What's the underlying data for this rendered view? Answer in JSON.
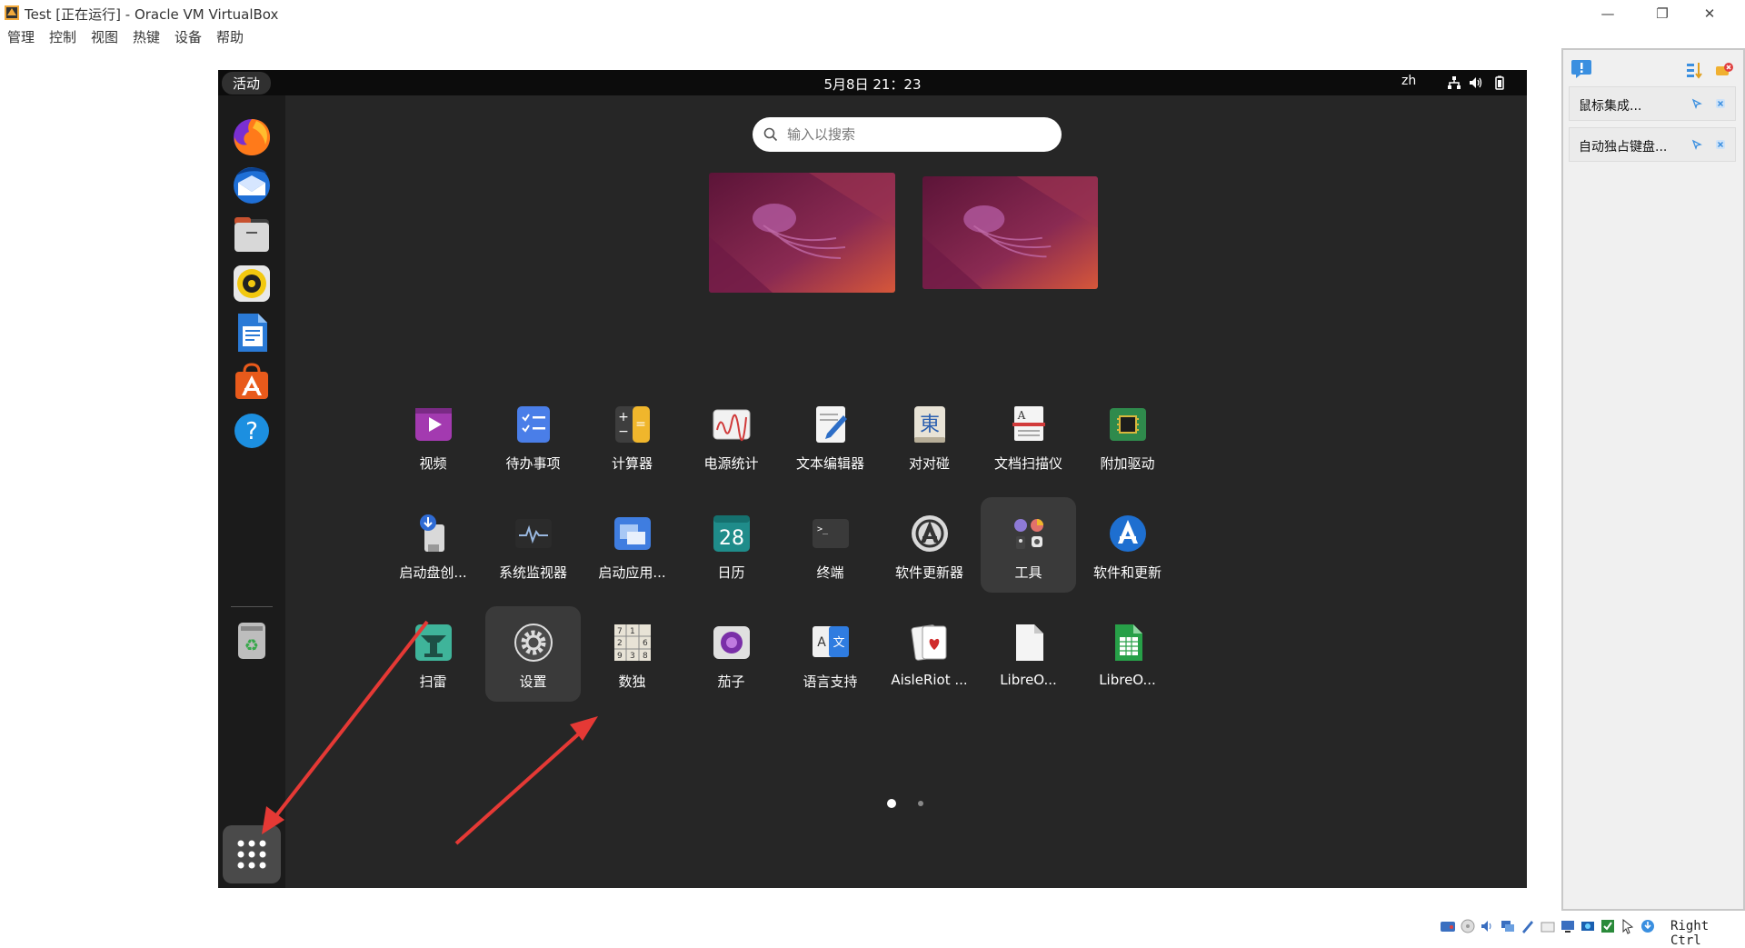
{
  "window": {
    "title": "Test [正在运行] - Oracle VM VirtualBox",
    "minimize_glyph": "—",
    "restore_glyph": "❐",
    "close_glyph": "✕"
  },
  "menubar": {
    "items": [
      "管理",
      "控制",
      "视图",
      "热键",
      "设备",
      "帮助"
    ]
  },
  "guest": {
    "activities_label": "活动",
    "clock": "5月8日  21：23",
    "input_language": "zh",
    "tray_icons": [
      "network-icon",
      "volume-icon",
      "battery-icon"
    ],
    "search": {
      "placeholder": "输入以搜索",
      "value": ""
    },
    "dock": [
      "firefox",
      "thunderbird",
      "files",
      "rhythmbox",
      "libreoffice-writer",
      "app-center",
      "help",
      "trash"
    ],
    "app_rows": [
      [
        "视频",
        "待办事项",
        "计算器",
        "电源统计",
        "文本编辑器",
        "对对碰",
        "文档扫描仪",
        "附加驱动"
      ],
      [
        "启动盘创...",
        "系统监视器",
        "启动应用...",
        "日历",
        "终端",
        "软件更新器",
        "工具",
        "软件和更新"
      ],
      [
        "扫雷",
        "设置",
        "数独",
        "茄子",
        "语言支持",
        "AisleRiot ...",
        "LibreO...",
        "LibreO..."
      ]
    ],
    "icon_glyphs": {
      "calendar_day": "28",
      "han_character": "東",
      "terminal_prompt": ">_",
      "text_a": "A",
      "translate_char": "文",
      "calculator_plus": "+",
      "calculator_minus": "−",
      "calculator_equals": "=",
      "help_mark": "?",
      "recycle": "♻",
      "sudoku_cells": [
        "7",
        "1",
        "2",
        "6",
        "9",
        "3",
        "8"
      ]
    },
    "pager": {
      "pages": 2,
      "current": 1
    }
  },
  "side_panel": {
    "notifications": [
      "鼠标集成...",
      "自动独占键盘..."
    ]
  },
  "statusbar": {
    "host_key": "Right Ctrl"
  }
}
